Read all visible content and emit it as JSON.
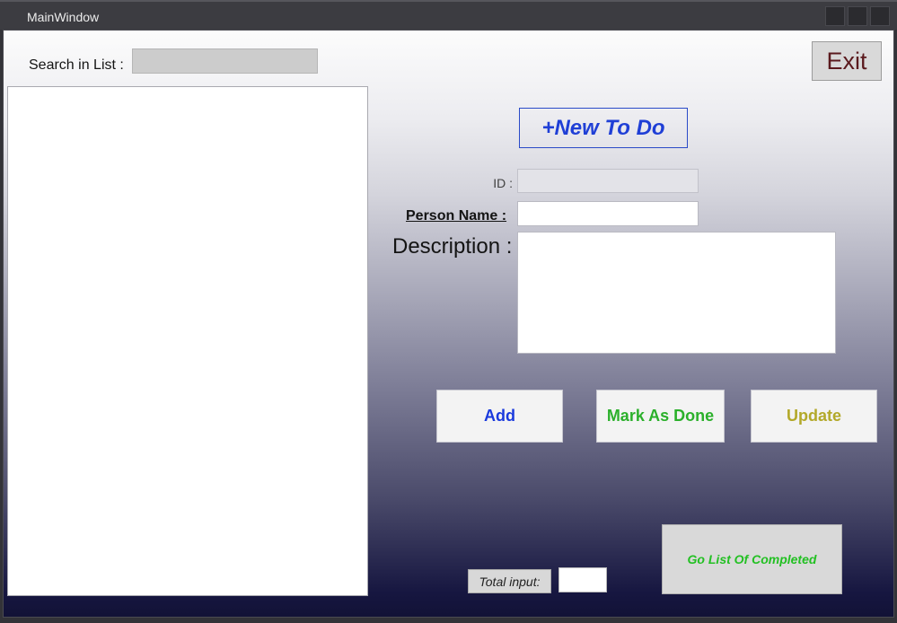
{
  "window": {
    "title": "MainWindow"
  },
  "search": {
    "label": "Search in List :",
    "value": ""
  },
  "exit_button": {
    "label": "Exit"
  },
  "todo_list": {
    "items": []
  },
  "new_todo_button": {
    "label": "+New To Do"
  },
  "form": {
    "id_label": "ID :",
    "id_value": "",
    "person_name_label": "Person Name :",
    "person_name_value": "",
    "description_label": "Description :",
    "description_value": ""
  },
  "actions": {
    "add": "Add",
    "mark_done": "Mark As Done",
    "update": "Update"
  },
  "go_completed_button": {
    "label": "Go List Of Completed"
  },
  "total": {
    "label": "Total input:",
    "value": ""
  },
  "colors": {
    "new_todo": "#1f3fd6",
    "add": "#1a3add",
    "mark_done": "#2bb02b",
    "update": "#b3a92a",
    "go_completed": "#22c022",
    "exit_text": "#5b1a1e"
  }
}
